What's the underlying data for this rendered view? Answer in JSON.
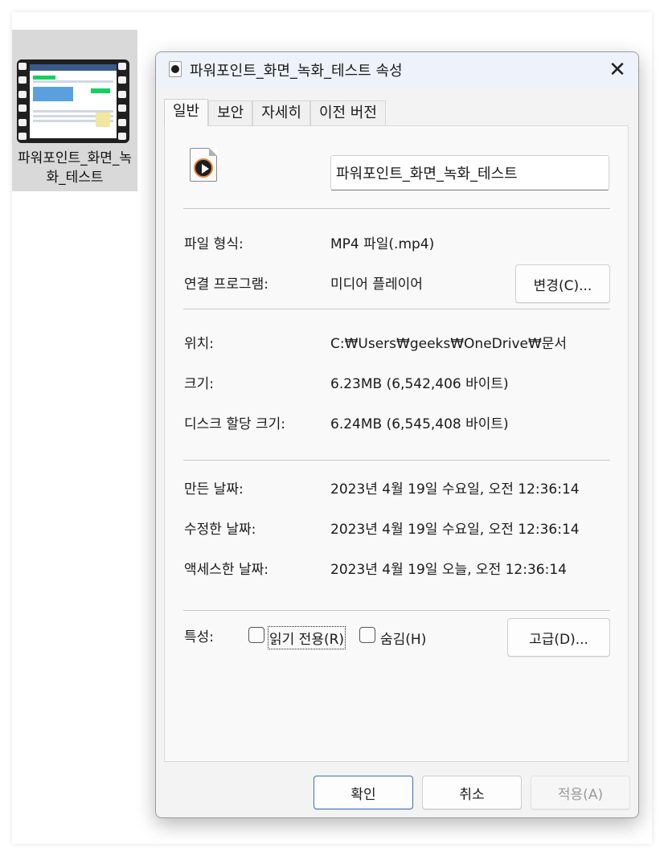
{
  "desktop_file": {
    "name": "파워포인트_화면_녹화_테스트"
  },
  "dialog": {
    "title": "파워포인트_화면_녹화_테스트 속성",
    "close_glyph": "✕",
    "tabs": [
      {
        "label": "일반",
        "active": true
      },
      {
        "label": "보안",
        "active": false
      },
      {
        "label": "자세히",
        "active": false
      },
      {
        "label": "이전 버전",
        "active": false
      }
    ],
    "file_name_value": "파워포인트_화면_녹화_테스트",
    "file_type_label": "파일 형식:",
    "file_type_value": "MP4 파일(.mp4)",
    "opens_with_label": "연결 프로그램:",
    "opens_with_value": "미디어 플레이어",
    "change_button": "변경(C)...",
    "location_label": "위치:",
    "location_value": "C:₩Users₩geeks₩OneDrive₩문서",
    "size_label": "크기:",
    "size_value": "6.23MB (6,542,406 바이트)",
    "disk_size_label": "디스크 할당 크기:",
    "disk_size_value": "6.24MB (6,545,408 바이트)",
    "created_label": "만든 날짜:",
    "created_value": "2023년 4월 19일 수요일, 오전 12:36:14",
    "modified_label": "수정한 날짜:",
    "modified_value": "2023년 4월 19일 수요일, 오전 12:36:14",
    "accessed_label": "액세스한 날짜:",
    "accessed_value": "2023년 4월 19일 오늘, 오전 12:36:14",
    "attributes_label": "특성:",
    "readonly_label": "읽기 전용(R)",
    "readonly_checked": false,
    "hidden_label": "숨김(H)",
    "hidden_checked": false,
    "advanced_button": "고급(D)...",
    "ok_button": "확인",
    "cancel_button": "취소",
    "apply_button": "적용(A)"
  },
  "colors": {
    "primary_border": "#3f6fb2",
    "titlebar_bg": "#eef2fa",
    "dialog_bg": "#f3f3f3"
  }
}
